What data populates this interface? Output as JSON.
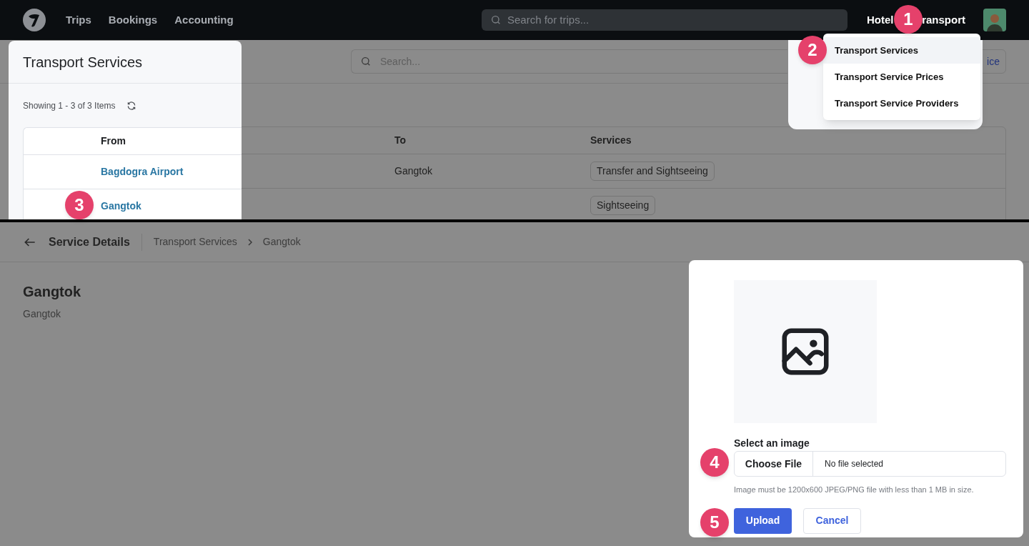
{
  "navbar": {
    "links": [
      "Trips",
      "Bookings",
      "Accounting"
    ],
    "search": {
      "placeholder": "Search for trips..."
    },
    "right_links": [
      "Hotel",
      "ransport"
    ]
  },
  "menu": {
    "items": [
      {
        "label": "Transport Services",
        "selected": true
      },
      {
        "label": "Transport Service Prices",
        "selected": false
      },
      {
        "label": "Transport Service Providers",
        "selected": false
      }
    ]
  },
  "list_page": {
    "title": "Transport Services",
    "search": {
      "placeholder": "Search..."
    },
    "button_fragment": "ice",
    "count": "Showing 1 - 3 of 3 Items",
    "table": {
      "columns": [
        "From",
        "To",
        "Services"
      ],
      "rows": [
        {
          "from": "Bagdogra Airport",
          "to": "Gangtok",
          "services": "Transfer and Sightseeing"
        },
        {
          "from": "Gangtok",
          "services": "Sightseeing"
        }
      ]
    }
  },
  "detail_page": {
    "header": "Service Details",
    "breadcrumb": [
      "Transport Services",
      "Gangtok"
    ],
    "title": "Gangtok",
    "subtitle": "Gangtok"
  },
  "upload_dialog": {
    "label": "Select an image",
    "choose_button": "Choose File",
    "file_status": "No file selected",
    "hint": "Image must be 1200x600 JPEG/PNG file with less than 1 MB in size.",
    "buttons": [
      {
        "label": "Upload",
        "kind": "primary"
      },
      {
        "label": "Cancel",
        "kind": "secondary"
      }
    ]
  },
  "steps": [
    "1",
    "2",
    "3",
    "4",
    "5"
  ]
}
